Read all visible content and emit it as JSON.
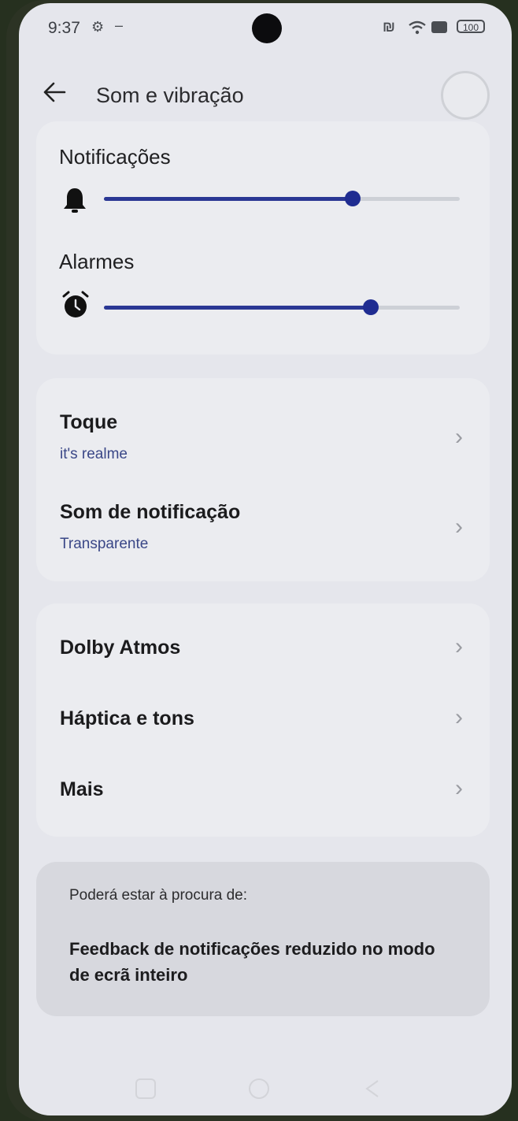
{
  "status_bar": {
    "time": "9:37",
    "battery": "100",
    "nfc_icon": "nfc-icon",
    "wifi_icon": "wifi-icon",
    "sim_icon": "sim-icon"
  },
  "header": {
    "back_icon": "arrow-left-icon",
    "title": "Som e vibração"
  },
  "volume": {
    "notifications": {
      "label": "Notificações",
      "icon": "bell-icon",
      "level": 0.7
    },
    "alarms": {
      "label": "Alarmes",
      "icon": "alarm-clock-icon",
      "level": 0.75
    }
  },
  "sounds": {
    "ringtone": {
      "title": "Toque",
      "value": "it's realme"
    },
    "notification_sound": {
      "title": "Som de notificação",
      "value": "Transparente"
    }
  },
  "more": {
    "dolby": "Dolby Atmos",
    "haptics": "Háptica e tons",
    "more": "Mais"
  },
  "suggestion": {
    "label": "Poderá estar à procura de:",
    "text": "Feedback de notificações reduzido no modo de ecrã inteiro"
  },
  "colors": {
    "accent": "#1f2c91",
    "background": "#e5e6ec"
  }
}
